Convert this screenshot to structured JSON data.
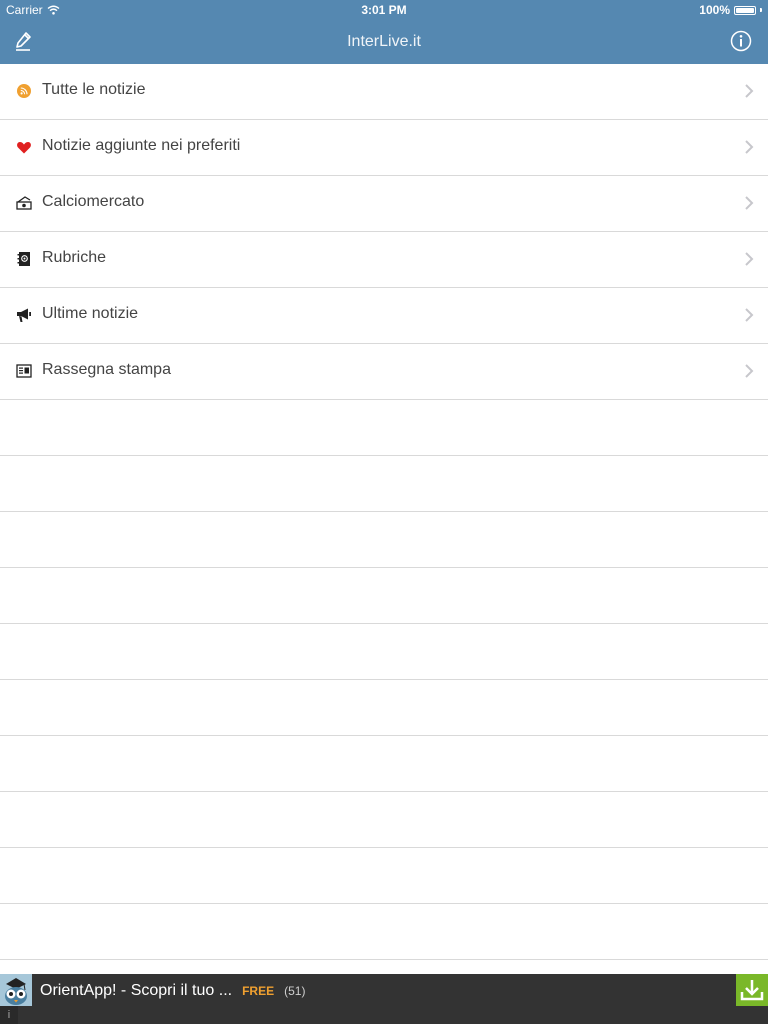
{
  "status_bar": {
    "carrier": "Carrier",
    "time": "3:01 PM",
    "battery": "100%"
  },
  "navbar": {
    "title": "InterLive.it",
    "compose_icon": "compose-icon",
    "info_icon": "info-icon"
  },
  "menu": {
    "items": [
      {
        "label": "Tutte le notizie",
        "icon": "rss-icon"
      },
      {
        "label": "Notizie aggiunte nei preferiti",
        "icon": "heart-icon"
      },
      {
        "label": "Calciomercato",
        "icon": "money-icon"
      },
      {
        "label": "Rubriche",
        "icon": "address-book-icon"
      },
      {
        "label": "Ultime notizie",
        "icon": "megaphone-icon"
      },
      {
        "label": "Rassegna stampa",
        "icon": "newspaper-icon"
      }
    ]
  },
  "ad": {
    "title": "OrientApp! - Scopri il tuo ...",
    "price": "FREE",
    "reviews": "(51)",
    "info": "i"
  },
  "colors": {
    "header": "#5588b1",
    "rss": "#f0a030",
    "heart": "#e02020",
    "ad_bg": "#333333",
    "download": "#7ab829"
  }
}
